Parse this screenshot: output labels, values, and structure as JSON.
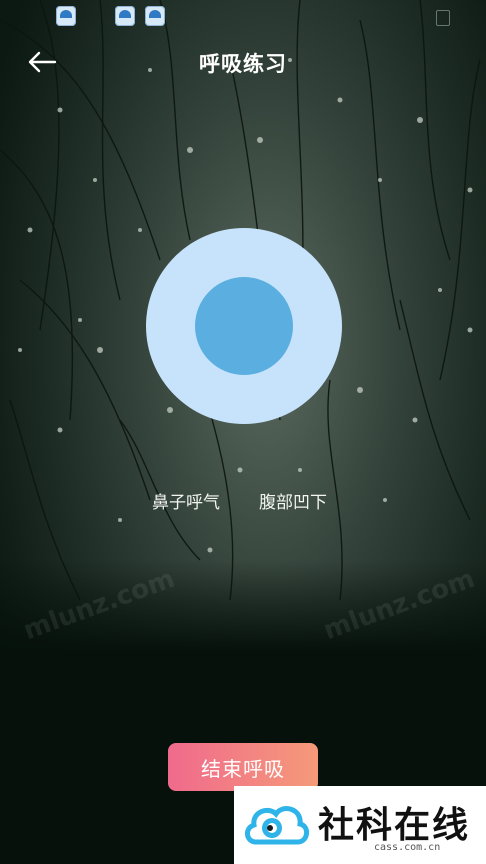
{
  "header": {
    "title": "呼吸练习"
  },
  "breathing": {
    "hint_left": "鼻子呼气",
    "hint_right": "腹部凹下"
  },
  "actions": {
    "end_label": "结束呼吸"
  },
  "watermark": {
    "brand": "社科在线",
    "url": "cass.com.cn"
  },
  "colors": {
    "outer_circle": "#c7e3fb",
    "inner_circle": "#5aaee0",
    "button_start": "#f06a8c",
    "button_end": "#f59a79"
  }
}
